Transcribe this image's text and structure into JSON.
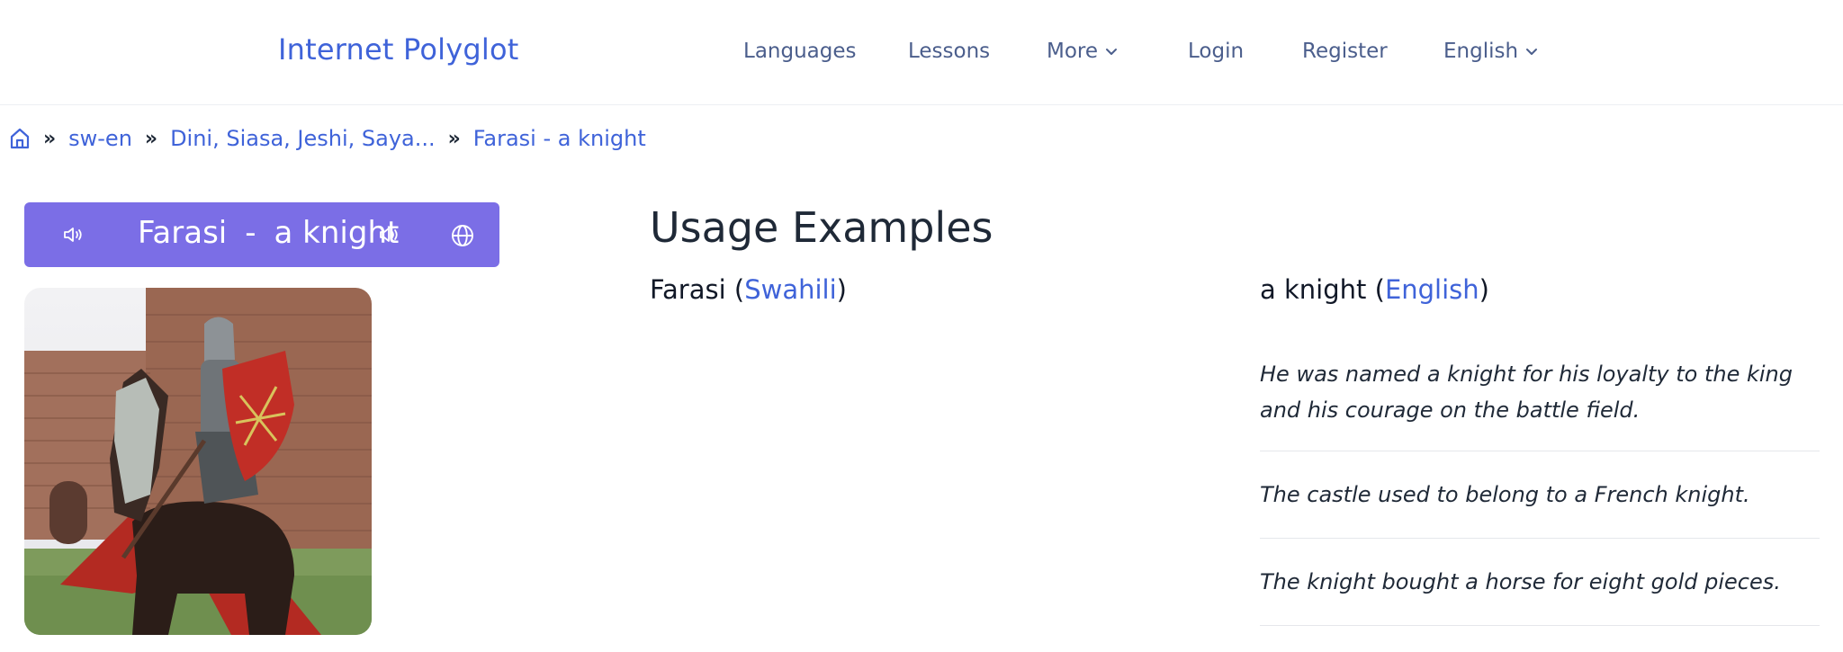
{
  "header": {
    "brand": "Internet Polyglot",
    "nav": [
      {
        "label": "Languages"
      },
      {
        "label": "Lessons"
      },
      {
        "label": "More"
      },
      {
        "label": "Login"
      },
      {
        "label": "Register"
      },
      {
        "label": "English"
      }
    ]
  },
  "breadcrumb": {
    "items": [
      "sw-en",
      "Dini, Siasa, Jeshi, Saya...",
      "Farasi - a knight"
    ]
  },
  "word_card": {
    "word": "Farasi",
    "separator": "-",
    "translation": "a knight"
  },
  "usage": {
    "heading": "Usage Examples",
    "left_word": "Farasi",
    "left_lang": "Swahili",
    "right_word": "a knight",
    "right_lang": "English",
    "examples": [
      "He was named a knight for his loyalty to the king and his courage on the battle field.",
      "The castle used to belong to a French knight.",
      "The knight bought a horse for eight gold pieces."
    ]
  },
  "colors": {
    "brand": "#3f63d9",
    "card_bg": "#7b6ee6",
    "nav_text": "#4b5e8c"
  }
}
